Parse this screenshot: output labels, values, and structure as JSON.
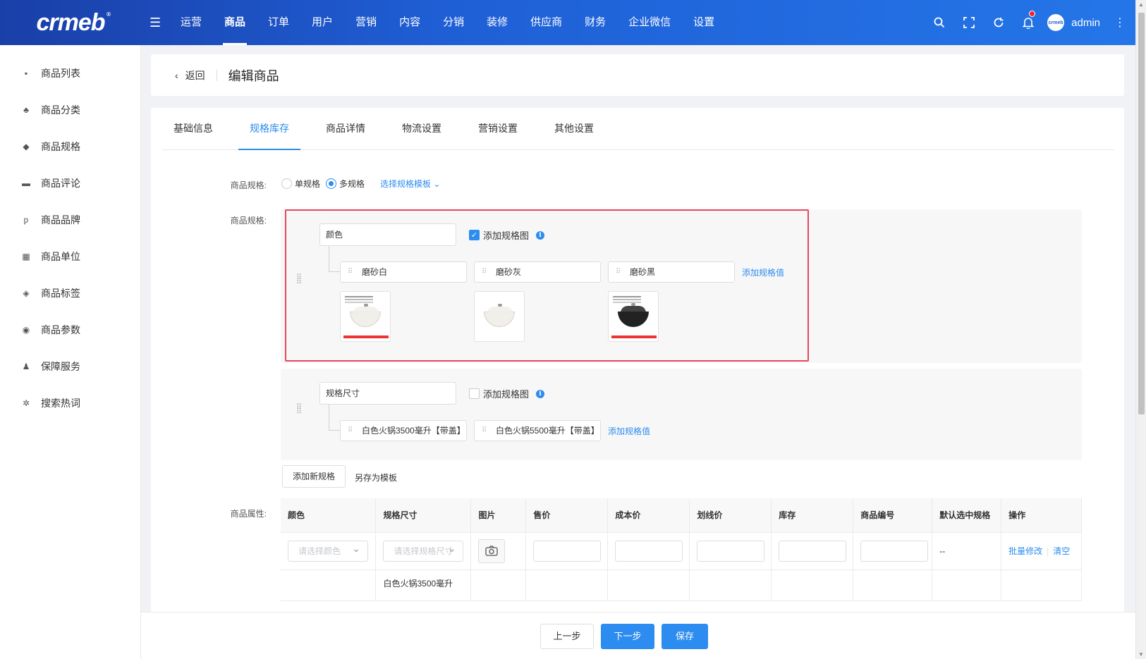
{
  "app": {
    "logo_text": "crmeb",
    "logo_mark": "®"
  },
  "topnav": {
    "items": [
      "运营",
      "商品",
      "订单",
      "用户",
      "营销",
      "内容",
      "分销",
      "装修",
      "供应商",
      "财务",
      "企业微信",
      "设置"
    ],
    "active": "商品"
  },
  "user": {
    "name": "admin",
    "avatar_text": "crmeb"
  },
  "icons": {
    "search": "search-icon",
    "fullscreen": "fullscreen-icon",
    "refresh": "refresh-icon",
    "bell": "bell-icon",
    "more": "more-icon"
  },
  "sidebar": {
    "items": [
      {
        "label": "商品列表",
        "icon": "shop-bag-icon"
      },
      {
        "label": "商品分类",
        "icon": "category-icon"
      },
      {
        "label": "商品规格",
        "icon": "cube-icon"
      },
      {
        "label": "商品评论",
        "icon": "comment-icon"
      },
      {
        "label": "商品品牌",
        "icon": "brand-icon"
      },
      {
        "label": "商品单位",
        "icon": "grid-icon"
      },
      {
        "label": "商品标签",
        "icon": "tag-icon"
      },
      {
        "label": "商品参数",
        "icon": "eye-icon"
      },
      {
        "label": "保障服务",
        "icon": "person-icon"
      },
      {
        "label": "搜索热词",
        "icon": "hot-search-icon"
      }
    ]
  },
  "header": {
    "back_label": "返回",
    "title": "编辑商品"
  },
  "tabs": [
    "基础信息",
    "规格库存",
    "商品详情",
    "物流设置",
    "营销设置",
    "其他设置"
  ],
  "active_tab": "规格库存",
  "form": {
    "spec_type_label": "商品规格:",
    "single_label": "单规格",
    "multi_label": "多规格",
    "template_link": "选择规格模板",
    "spec_label": "商品规格:",
    "attr_label": "商品属性:"
  },
  "specs": [
    {
      "name": "颜色",
      "add_image_label": "添加规格图",
      "add_image_checked": true,
      "values": [
        "磨砂白",
        "磨砂灰",
        "磨砂黑"
      ],
      "add_value_label": "添加规格值"
    },
    {
      "name": "规格尺寸",
      "add_image_label": "添加规格图",
      "add_image_checked": false,
      "values": [
        "白色火锅3500毫升【带盖】",
        "白色火锅5500毫升【带盖】"
      ],
      "add_value_label": "添加规格值"
    }
  ],
  "actions": {
    "add_spec": "添加新规格",
    "save_template": "另存为模板"
  },
  "table": {
    "headers": [
      "颜色",
      "规格尺寸",
      "图片",
      "售价",
      "成本价",
      "划线价",
      "库存",
      "商品编号",
      "默认选中规格",
      "操作"
    ],
    "batch_row": {
      "color_placeholder": "请选择颜色",
      "size_placeholder": "请选择规格尺寸",
      "default_value": "--",
      "batch_edit": "批量修改",
      "clear": "清空"
    },
    "partial_row": {
      "size": "白色火锅3500毫升"
    }
  },
  "footer": {
    "prev": "上一步",
    "next": "下一步",
    "save": "保存"
  },
  "colors": {
    "accent": "#2d8cf0",
    "highlight_border": "#e8475c",
    "topbar_start": "#1a3fa8",
    "topbar_end": "#2476e8"
  }
}
